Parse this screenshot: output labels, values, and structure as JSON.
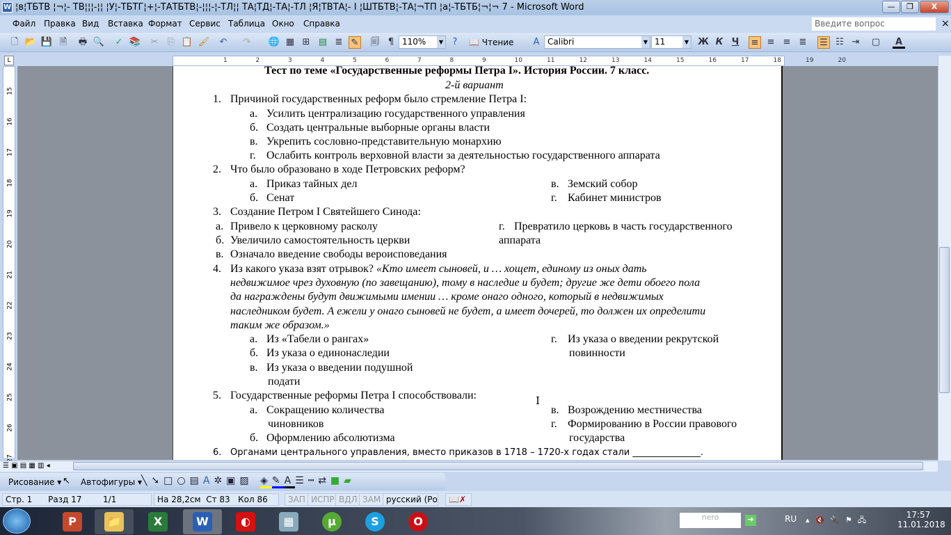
{
  "window": {
    "title": "¦в¦ТБТВ ¦¬¦- ТВ¦¦¦-¦¦ ¦У¦-ТБТГ¦+¦-ТАТБТВ¦-¦¦¦-¦-ТЛ¦¦ ТА¦ТД¦-ТА¦-ТЛ ¦Я¦ТВТА¦- I ¦ШТБТВ¦-ТА¦¬ТП ¦а¦-ТБТБ¦¬¦¬ 7 - Microsoft Word",
    "minimize": "—",
    "restore": "❐",
    "close": "X"
  },
  "menu": {
    "items": [
      "Файл",
      "Правка",
      "Вид",
      "Вставка",
      "Формат",
      "Сервис",
      "Таблица",
      "Окно",
      "Справка"
    ],
    "help_placeholder": "Введите вопрос",
    "close_doc": "×"
  },
  "toolbar": {
    "zoom": "110%",
    "reading": "Чтение",
    "font": "Calibri",
    "size": "11",
    "bold": "Ж",
    "italic": "К",
    "underline": "Ч",
    "pilcrow": "¶",
    "font_color": "A"
  },
  "ruler": {
    "h": [
      "1",
      "2",
      "3",
      "4",
      "5",
      "6",
      "7",
      "8",
      "9",
      "10",
      "11",
      "12",
      "13",
      "14",
      "15",
      "16",
      "17",
      "18",
      "19",
      "20"
    ],
    "v": [
      "15",
      "16",
      "17",
      "18",
      "19",
      "20",
      "21",
      "22",
      "23",
      "24",
      "25",
      "26",
      "27"
    ],
    "tab": "L"
  },
  "document": {
    "title": "Тест по теме «Государственные реформы Петра I». История России. 7 класс.",
    "variant": "2-й вариант",
    "q1": {
      "n": "1.",
      "text": "Причиной государственных реформ было стремление Петра I:",
      "a": [
        "Усилить централизацию государственного управления",
        "Создать центральные выборные органы власти",
        "Укрепить сословно-представительную монархию",
        "Ослабить контроль верховной власти за деятельностью государственного аппарата"
      ]
    },
    "q2": {
      "n": "2.",
      "text": "Что было образовано в ходе Петровских реформ?",
      "a": [
        "Приказ тайных дел",
        "Сенат",
        "Земский собор",
        "Кабинет министров"
      ]
    },
    "q3": {
      "n": "3.",
      "text": "Создание Петром I Святейшего Синода:",
      "a": [
        "Привело к церковному расколу",
        "Увеличило самостоятельность церкви",
        "Означало введение свободы вероисповедания",
        "Превратило церковь в часть государственного",
        "аппарата"
      ]
    },
    "q4": {
      "n": "4.",
      "text": "Из какого указа взят отрывок?",
      "quote": [
        "«Кто имеет сыновей, и … хощет, единому из оных дать",
        "недвижимое чрез духовную (по завещанию), тому в наследие и будет; другие же дети обоего пола",
        "да награждены будут движимыми имении … кроме онаго одного, который в недвижимых",
        "наследником будет. А ежели у онаго сыновей не будет, а имеет дочерей, то должен их определити",
        "таким же образом.»"
      ],
      "a": [
        "Из «Табели о рангах»",
        "Из указа о единонаследии",
        "Из указа о введении подушной",
        "подати",
        "Из указа о введении рекрутской",
        "повинности"
      ]
    },
    "q5": {
      "n": "5.",
      "text": "Государственные реформы Петра I способствовали:",
      "a": [
        "Сокращению количества",
        "чиновников",
        "Оформлению абсолютизма",
        "Возрождению местничества",
        "Формированию в России правового",
        "государства"
      ]
    },
    "q6": {
      "n": "6.",
      "text": "Органами центрального управления, вместо приказов в 1718 – 1720-х годах стали _______________."
    },
    "letters": [
      "а.",
      "б.",
      "в.",
      "г."
    ]
  },
  "drawing": {
    "draw": "Рисование ▾",
    "autoshapes": "Автофигуры ▾"
  },
  "status": {
    "page": "Стр. 1",
    "section": "Разд 17",
    "pages": "1/1",
    "at": "На 28,2см",
    "line": "Ст 83",
    "col": "Кол 86",
    "rec": "ЗАП",
    "trk": "ИСПР",
    "ext": "ВДЛ",
    "ovr": "ЗАМ",
    "lang": "русский (Ро"
  },
  "taskbar": {
    "lang": "RU",
    "time": "17:57",
    "date": "11.01.2018",
    "nero": "nero"
  }
}
